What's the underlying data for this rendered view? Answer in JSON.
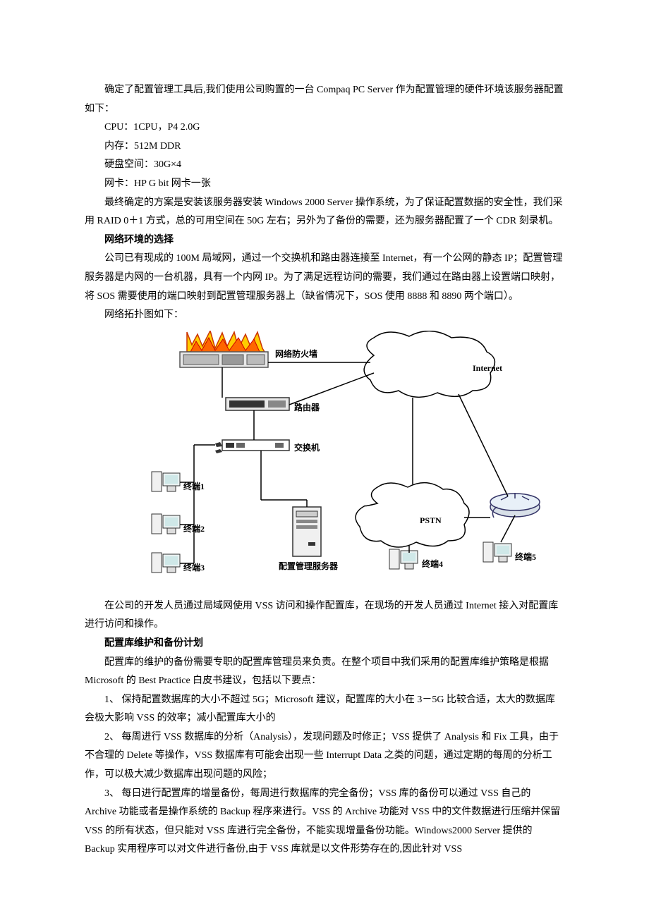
{
  "p1": "确定了配置管理工具后,我们使用公司购置的一台 Compaq PC Server 作为配置管理的硬件环境该服务器配置如下：",
  "spec_cpu": "CPU：1CPU，P4 2.0G",
  "spec_mem": "内存：512M DDR",
  "spec_disk": "硬盘空间：30G×4",
  "spec_nic": "网卡：HP G bit 网卡一张",
  "p2": "最终确定的方案是安装该服务器安装 Windows 2000 Server 操作系统，为了保证配置数据的安全性，我们采用 RAID 0＋1 方式，总的可用空间在 50G 左右；另外为了备份的需要，还为服务器配置了一个 CDR 刻录机。",
  "h1": "网络环境的选择",
  "p3": "公司已有现成的 100M 局域网，通过一个交换机和路由器连接至 Internet，有一个公网的静态 IP；配置管理服务器是内网的一台机器，具有一个内网 IP。为了满足远程访问的需要，我们通过在路由器上设置端口映射，将 SOS 需要使用的端口映射到配置管理服务器上（缺省情况下，SOS 使用 8888 和 8890 两个端口）。",
  "p4": "网络拓扑图如下：",
  "diagram": {
    "firewall": "网络防火墙",
    "router": "路由器",
    "switch": "交换机",
    "internet": "Internet",
    "pstn": "PSTN",
    "config_server": "配置管理服务器",
    "term1": "终端1",
    "term2": "终端2",
    "term3": "终端3",
    "term4": "终端4",
    "term5": "终端5"
  },
  "p5": "在公司的开发人员通过局域网使用 VSS 访问和操作配置库，在现场的开发人员通过 Internet 接入对配置库进行访问和操作。",
  "h2": "配置库维护和备份计划",
  "p6": "配置库的维护的备份需要专职的配置库管理员来负责。在整个项目中我们采用的配置库维护策略是根据 Microsoft 的 Best Practice 白皮书建议，包括以下要点：",
  "li1": "1、 保持配置数据库的大小不超过 5G；Microsoft 建议，配置库的大小在 3－5G 比较合适，太大的数据库会极大影响 VSS 的效率；减小配置库大小的",
  "li2": "2、 每周进行 VSS 数据库的分析（Analysis），发现问题及时修正；VSS 提供了 Analysis 和 Fix 工具，由于不合理的 Delete 等操作，VSS 数据库有可能会出现一些 Interrupt Data 之类的问题，通过定期的每周的分析工作，可以极大减少数据库出现问题的风险；",
  "li3": "3、 每日进行配置库的增量备份，每周进行数据库的完全备份；VSS 库的备份可以通过 VSS 自己的 Archive 功能或者是操作系统的 Backup 程序来进行。VSS 的 Archive 功能对 VSS 中的文件数据进行压缩并保留 VSS 的所有状态，但只能对 VSS 库进行完全备份，不能实现增量备份功能。Windows2000 Server 提供的 Backup 实用程序可以对文件进行备份,由于 VSS 库就是以文件形势存在的,因此针对 VSS"
}
